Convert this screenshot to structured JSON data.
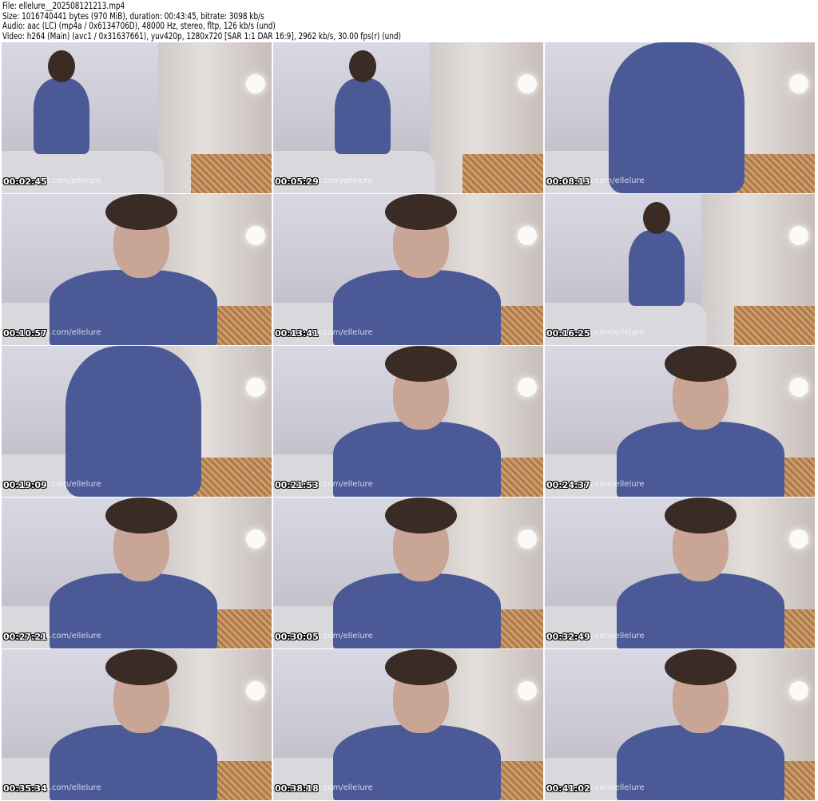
{
  "header": {
    "file": "File: ellelure__202508121213.mp4",
    "size": "Size: 1016740441 bytes (970 MiB), duration: 00:43:45, bitrate: 3098 kb/s",
    "audio": "Audio: aac (LC) (mp4a / 0x6134706D), 48000 Hz, stereo, fltp, 126 kb/s (und)",
    "video": "Video: h264 (Main) (avc1 / 0x31637661), yuv420p, 1280x720 [SAR 1:1 DAR 16:9], 2962 kb/s, 30.00 fps(r) (und)"
  },
  "watermark": "ans.com/ellelure",
  "thumbnails": [
    {
      "timestamp": "00:02:45",
      "shot": "wide"
    },
    {
      "timestamp": "00:05:29",
      "shot": "wide"
    },
    {
      "timestamp": "00:08:13",
      "shot": "torso"
    },
    {
      "timestamp": "00:10:57",
      "shot": "close"
    },
    {
      "timestamp": "00:13:41",
      "shot": "close"
    },
    {
      "timestamp": "00:16:25",
      "shot": "wide"
    },
    {
      "timestamp": "00:19:09",
      "shot": "torso"
    },
    {
      "timestamp": "00:21:53",
      "shot": "close"
    },
    {
      "timestamp": "00:24:37",
      "shot": "close"
    },
    {
      "timestamp": "00:27:21",
      "shot": "close"
    },
    {
      "timestamp": "00:30:05",
      "shot": "close"
    },
    {
      "timestamp": "00:32:49",
      "shot": "close"
    },
    {
      "timestamp": "00:35:34",
      "shot": "close"
    },
    {
      "timestamp": "00:38:18",
      "shot": "close"
    },
    {
      "timestamp": "00:41:02",
      "shot": "close"
    }
  ]
}
